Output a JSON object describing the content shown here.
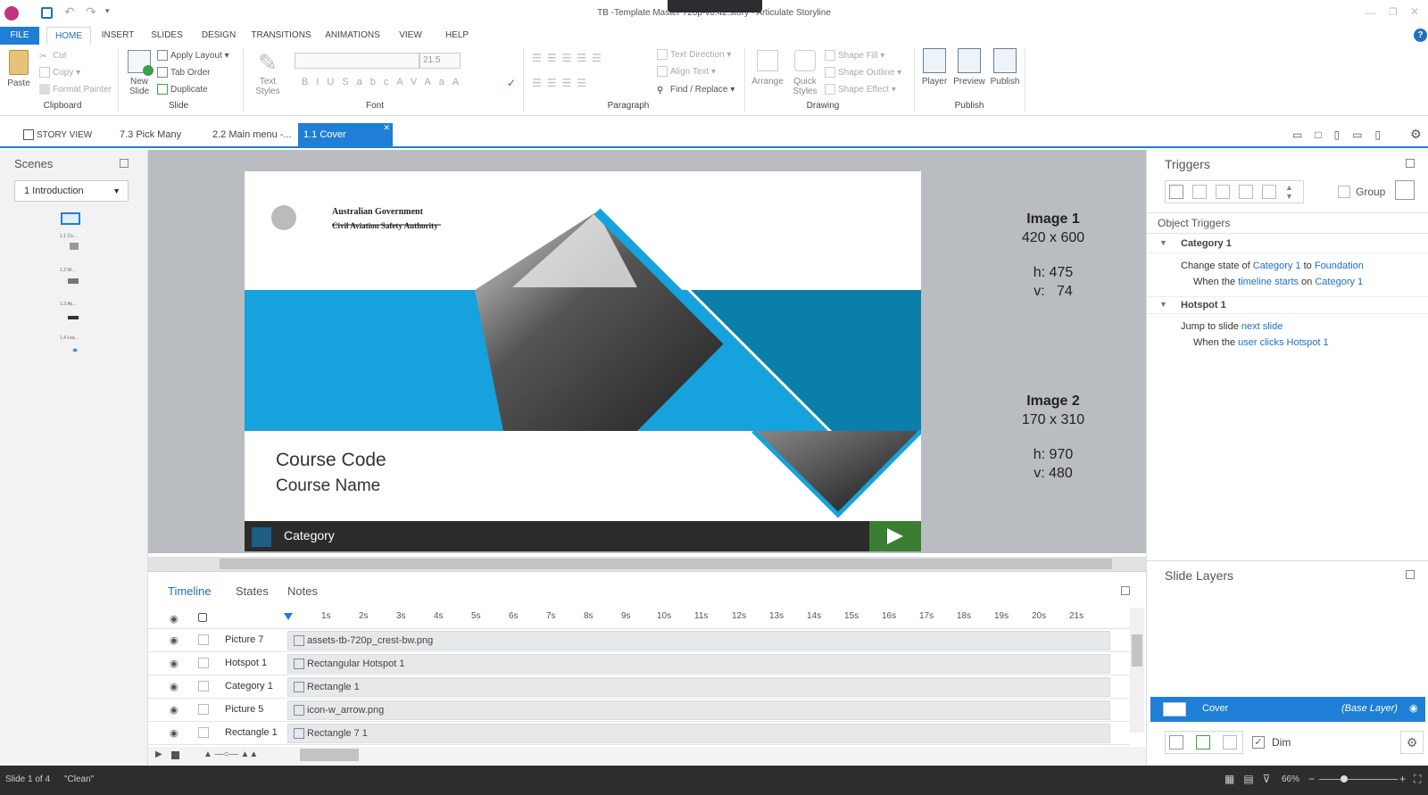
{
  "window": {
    "title": "TB -Template Master 720p-v0.42.story - Articulate Storyline"
  },
  "ribbon_tabs": [
    "FILE",
    "HOME",
    "INSERT",
    "SLIDES",
    "DESIGN",
    "TRANSITIONS",
    "ANIMATIONS",
    "VIEW",
    "HELP"
  ],
  "clipboard": {
    "paste": "Paste",
    "cut": "Cut",
    "copy": "Copy",
    "format_painter": "Format Painter",
    "label": "Clipboard"
  },
  "slide_grp": {
    "new_slide": "New Slide",
    "apply_layout": "Apply Layout",
    "tab_order": "Tab Order",
    "duplicate": "Duplicate",
    "label": "Slide"
  },
  "font_grp": {
    "text_styles": "Text Styles",
    "font_size": "21.5",
    "label": "Font"
  },
  "paragraph_grp": {
    "text_direction": "Text Direction",
    "align_text": "Align Text",
    "find_replace": "Find / Replace",
    "label": "Paragraph"
  },
  "drawing_grp": {
    "arrange": "Arrange",
    "quick_styles": "Quick Styles",
    "shape_fill": "Shape Fill",
    "shape_outline": "Shape Outline",
    "shape_effect": "Shape Effect",
    "label": "Drawing"
  },
  "publish_grp": {
    "player": "Player",
    "preview": "Preview",
    "publish": "Publish",
    "label": "Publish"
  },
  "doc_tabs": {
    "story_view": "STORY VIEW",
    "tab1": "7.3 Pick Many",
    "tab2": "2.2 Main menu -...",
    "tab3": "1.1 Cover"
  },
  "scenes": {
    "title": "Scenes",
    "selected": "1 Introduction",
    "thumbs": [
      "1.1 Co...",
      "1.2 W...",
      "1.3 Ab...",
      "1.4 Lea..."
    ]
  },
  "slide": {
    "gov_line1": "Australian Government",
    "gov_line2": "Civil Aviation Safety Authority",
    "course_code": "Course Code",
    "course_name": "Course Name",
    "category": "Category"
  },
  "notes_right": {
    "img1_title": "Image 1",
    "img1_size": "420 x 600",
    "img1_h": "h: 475",
    "img1_v": "v:   74",
    "img2_title": "Image 2",
    "img2_size": "170 x 310",
    "img2_h": "h: 970",
    "img2_v": "v: 480"
  },
  "timeline": {
    "tabs": [
      "Timeline",
      "States",
      "Notes"
    ],
    "ticks": [
      "1s",
      "2s",
      "3s",
      "4s",
      "5s",
      "6s",
      "7s",
      "8s",
      "9s",
      "10s",
      "11s",
      "12s",
      "13s",
      "14s",
      "15s",
      "16s",
      "17s",
      "18s",
      "19s",
      "20s",
      "21s"
    ],
    "rows": [
      {
        "name": "Picture 7",
        "bar": "assets-tb-720p_crest-bw.png"
      },
      {
        "name": "Hotspot 1",
        "bar": "Rectangular Hotspot 1"
      },
      {
        "name": "Category 1",
        "bar": "Rectangle 1"
      },
      {
        "name": "Picture 5",
        "bar": "icon-w_arrow.png"
      },
      {
        "name": "Rectangle 1",
        "bar": "Rectangle 7 1"
      }
    ]
  },
  "triggers": {
    "title": "Triggers",
    "group": "Group",
    "object_triggers": "Object Triggers",
    "g1": {
      "name": "Category 1",
      "l1a": "Change state of ",
      "l1b": "Category 1",
      "l1c": " to ",
      "l1d": "Foundation",
      "l2a": "When the ",
      "l2b": "timeline starts",
      "l2c": " on ",
      "l2d": "Category 1"
    },
    "g2": {
      "name": "Hotspot 1",
      "l1a": "Jump to slide ",
      "l1b": "next slide",
      "l2a": "When the ",
      "l2b": "user clicks",
      "l2c": " ",
      "l2d": "Hotspot 1"
    }
  },
  "layers": {
    "title": "Slide Layers",
    "base_name": "Cover",
    "base_tag": "(Base Layer)",
    "dim": "Dim"
  },
  "status": {
    "slide": "Slide 1 of 4",
    "clean": "\"Clean\"",
    "zoom": "66%"
  },
  "colors": {
    "accent": "#1f7fd6",
    "slide_blue": "#16a2dc",
    "slide_dark_blue": "#0b7ea9",
    "cat_bar": "#2b2b2b",
    "play_green": "#3a7d33"
  }
}
